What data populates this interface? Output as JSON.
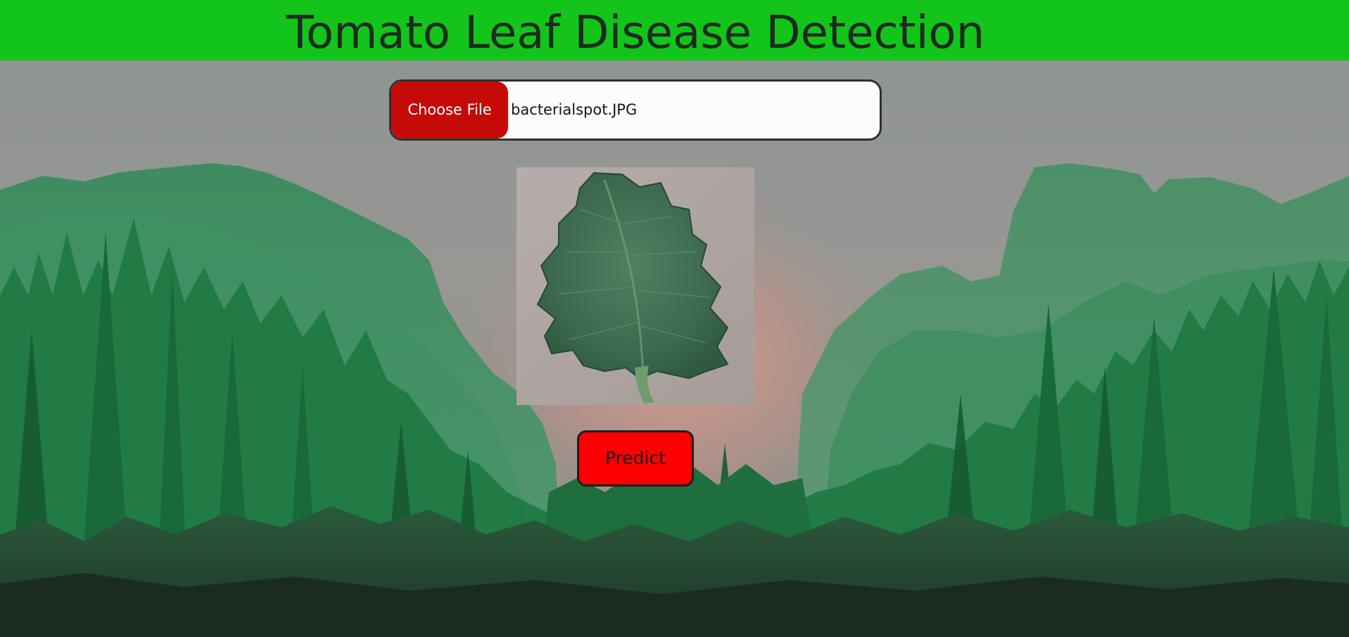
{
  "header": {
    "title": "Tomato Leaf Disease Detection",
    "background_color": "#13c41a"
  },
  "upload": {
    "button_label": "Choose File",
    "file_name": "bacterialspot.JPG",
    "button_color": "#c50a08"
  },
  "preview": {
    "subject": "tomato leaf"
  },
  "predict": {
    "label": "Predict",
    "button_color": "#fe0000"
  },
  "background": {
    "scene": "misty mountain valley with green pine forest"
  }
}
